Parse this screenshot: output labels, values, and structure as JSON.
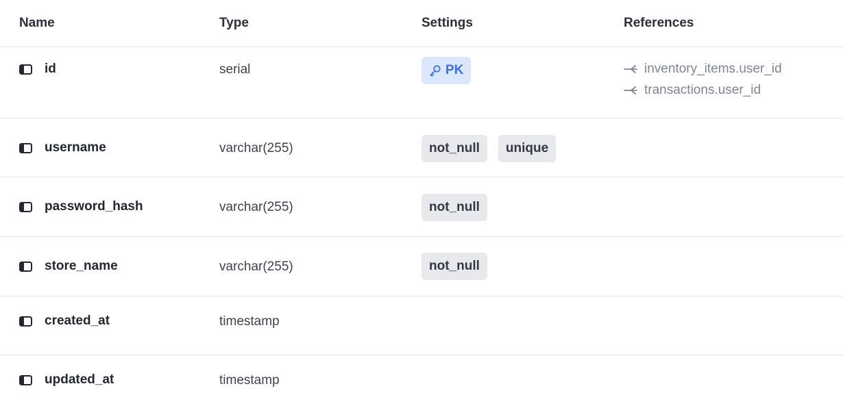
{
  "header": {
    "name": "Name",
    "type": "Type",
    "settings": "Settings",
    "references": "References"
  },
  "rows": [
    {
      "name": "id",
      "type": "serial",
      "pk_label": "PK",
      "references": [
        "inventory_items.user_id",
        "transactions.user_id"
      ]
    },
    {
      "name": "username",
      "type": "varchar(255)",
      "settings": [
        "not_null",
        "unique"
      ]
    },
    {
      "name": "password_hash",
      "type": "varchar(255)",
      "settings": [
        "not_null"
      ]
    },
    {
      "name": "store_name",
      "type": "varchar(255)",
      "settings": [
        "not_null"
      ]
    },
    {
      "name": "created_at",
      "type": "timestamp"
    },
    {
      "name": "updated_at",
      "type": "timestamp"
    }
  ],
  "colors": {
    "pk_background": "#dbe6ff",
    "pk_text": "#3a6ff0",
    "badge_background": "#e8e9ed",
    "reference_text": "#7d8596",
    "divider": "#e3e5ea"
  },
  "icons": {
    "column": "column-icon",
    "key": "key-icon",
    "reference": "reference-arrow-icon"
  }
}
